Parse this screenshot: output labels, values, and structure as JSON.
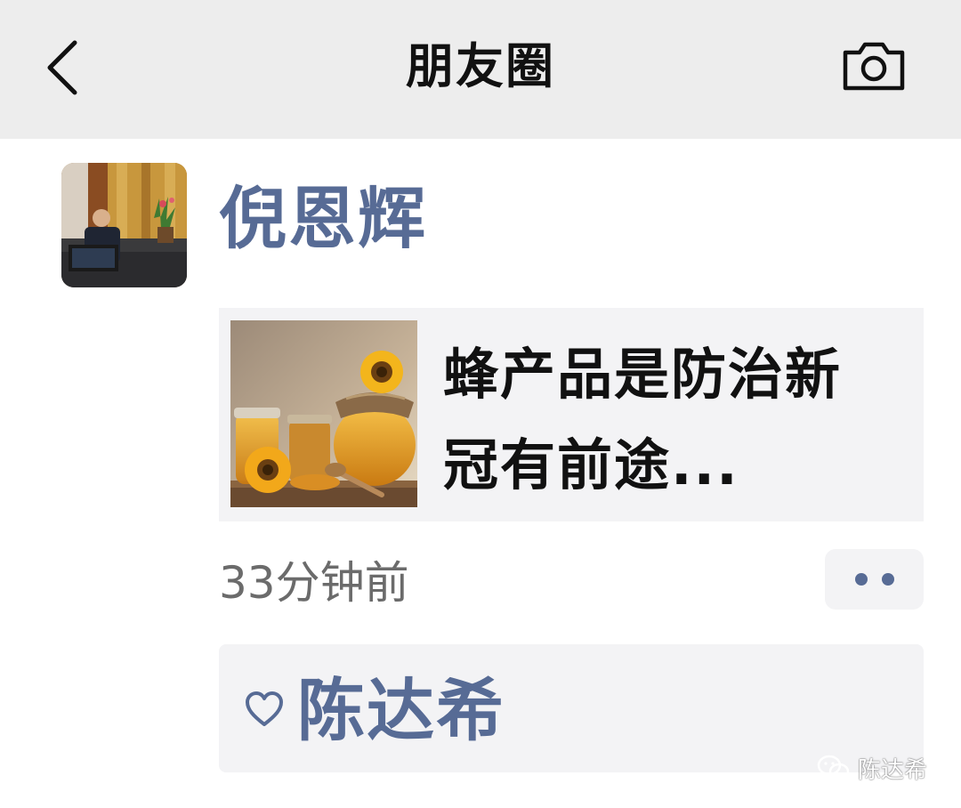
{
  "navbar": {
    "title": "朋友圈",
    "back_icon": "chevron-left-icon",
    "camera_icon": "camera-icon",
    "background": "#ededed"
  },
  "post": {
    "author": "倪恩辉",
    "link": {
      "title": "蜂产品是防治新冠有前途..."
    },
    "time": "33分钟前",
    "likes": {
      "icon": "heart-outline-icon",
      "names": "陈达希"
    }
  },
  "watermark": {
    "text": "陈达希",
    "icon": "wechat-icon"
  },
  "colors": {
    "name_link": "#576b95",
    "card_bg": "#f3f3f5",
    "title_text": "#111111",
    "time_text": "#6b6b6b"
  }
}
